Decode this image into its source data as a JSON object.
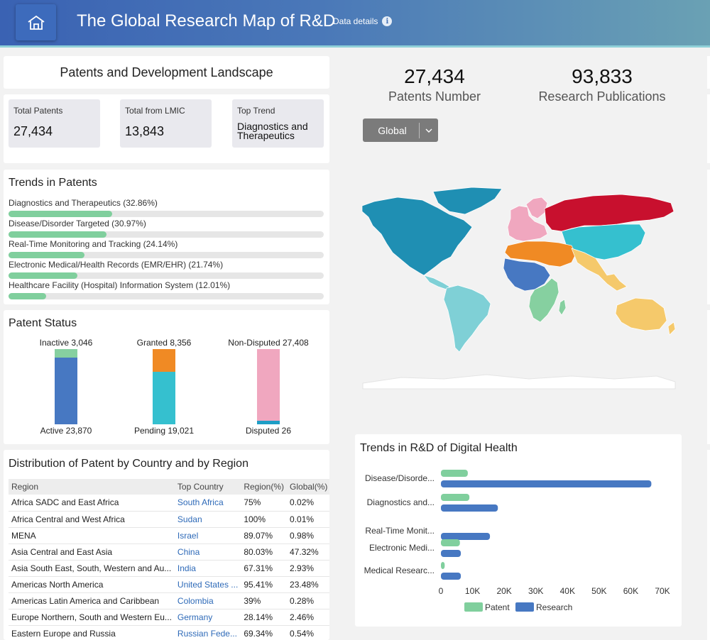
{
  "header": {
    "title": "The Global Research Map of R&D",
    "data_details": "Data details",
    "icons": {
      "home": "home-icon",
      "info": "info-icon"
    }
  },
  "landscape": {
    "title": "Patents and Development Landscape"
  },
  "kpis": {
    "total_patents": {
      "label": "Total Patents",
      "value": "27,434"
    },
    "total_lmic": {
      "label": "Total from LMIC",
      "value": "13,843"
    },
    "top_trend": {
      "label": "Top Trend",
      "value": "Diagnostics and Therapeutics"
    }
  },
  "trends": {
    "title": "Trends in Patents",
    "items": [
      {
        "label": "Diagnostics and Therapeutics (32.86%)",
        "pct": 32.86
      },
      {
        "label": "Disease/Disorder Targeted (30.97%)",
        "pct": 30.97
      },
      {
        "label": "Real-Time Monitoring and Tracking (24.14%)",
        "pct": 24.14
      },
      {
        "label": "Electronic Medical/Health Records (EMR/EHR) (21.74%)",
        "pct": 21.74
      },
      {
        "label": "Healthcare Facility (Hospital) Information System (12.01%)",
        "pct": 12.01
      }
    ]
  },
  "status": {
    "title": "Patent Status",
    "bars": [
      {
        "top_label": "Inactive 3,046",
        "bottom_label": "Active 23,870",
        "top_value": 3046,
        "bottom_value": 23870,
        "top_color": "#86d0a0",
        "bottom_color": "#4778c2"
      },
      {
        "top_label": "Granted 8,356",
        "bottom_label": "Pending 19,021",
        "top_value": 8356,
        "bottom_value": 19021,
        "top_color": "#f08a24",
        "bottom_color": "#35c0cf"
      },
      {
        "top_label": "Non-Disputed 27,408",
        "bottom_label": "Disputed 26",
        "top_value": 27408,
        "bottom_value": 26,
        "top_color": "#f0a7bf",
        "bottom_color": "#1f9ec6"
      }
    ]
  },
  "distribution": {
    "title": "Distribution of Patent by Country and by Region",
    "columns": [
      "Region",
      "Top Country",
      "Region(%)",
      "Global(%)"
    ],
    "rows": [
      [
        "Africa SADC and East Africa",
        "South Africa",
        "75%",
        "0.02%"
      ],
      [
        "Africa Central and West Africa",
        "Sudan",
        "100%",
        "0.01%"
      ],
      [
        "MENA",
        "Israel",
        "89.07%",
        "0.98%"
      ],
      [
        "Asia Central and East Asia",
        "China",
        "80.03%",
        "47.32%"
      ],
      [
        "Asia South East, South, Western and Au...",
        "India",
        "67.31%",
        "2.93%"
      ],
      [
        "Americas North America",
        "United States ...",
        "95.41%",
        "23.48%"
      ],
      [
        "Americas Latin America and Caribbean",
        "Colombia",
        "39%",
        "0.28%"
      ],
      [
        "Europe Northern, South and Western Eu...",
        "Germany",
        "28.14%",
        "2.46%"
      ],
      [
        "Eastern Europe and Russia",
        "Russian Fede...",
        "69.34%",
        "0.54%"
      ]
    ]
  },
  "summary": {
    "patents_number": {
      "value": "27,434",
      "label": "Patents Number"
    },
    "research_publications": {
      "value": "93,833",
      "label": "Research Publications"
    }
  },
  "region_select": {
    "value": "Global"
  },
  "map_colors": {
    "north_america": "#1f8fb3",
    "latin_america": "#7fd0d6",
    "europe_west": "#f0a7bf",
    "russia": "#c8102e",
    "central_east_asia": "#35c0cf",
    "south_asia_australia": "#f5c96b",
    "mena": "#f08a24",
    "africa_west": "#4778c2",
    "africa_sadc": "#86d0a0"
  },
  "chart_data": {
    "type": "bar",
    "orientation": "horizontal",
    "title": "Trends in R&D of Digital Health",
    "categories": [
      "Disease/Disorde...",
      "Diagnostics and...",
      "Real-Time Monit...",
      "Electronic Medi...",
      "Medical Researc..."
    ],
    "series": [
      {
        "name": "Patent",
        "color": "#80cf9d",
        "values": [
          8500,
          9000,
          0,
          6000,
          1200
        ]
      },
      {
        "name": "Research",
        "color": "#4778c2",
        "values": [
          66500,
          18000,
          15500,
          6300,
          6300
        ]
      }
    ],
    "xlim": [
      0,
      70000
    ],
    "xticks": [
      "0",
      "10K",
      "20K",
      "30K",
      "40K",
      "50K",
      "60K",
      "70K"
    ],
    "legend": "bottom"
  }
}
